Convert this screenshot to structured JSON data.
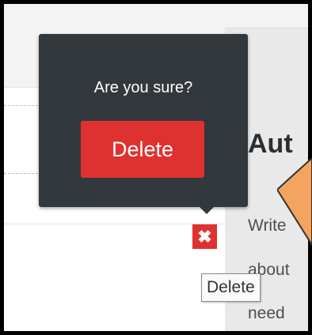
{
  "popover": {
    "question": "Are you sure?",
    "confirm_label": "Delete"
  },
  "item_actions": {
    "delete_icon": "close-icon",
    "delete_glyph": "✖"
  },
  "tooltip": {
    "text": "Delete"
  },
  "side_panel": {
    "heading": "Aut",
    "line1": "Write",
    "line2": "about",
    "line3": "need"
  },
  "colors": {
    "popover_bg": "#33383c",
    "danger": "#e03131",
    "annotation_arrow": "#f4a460"
  }
}
